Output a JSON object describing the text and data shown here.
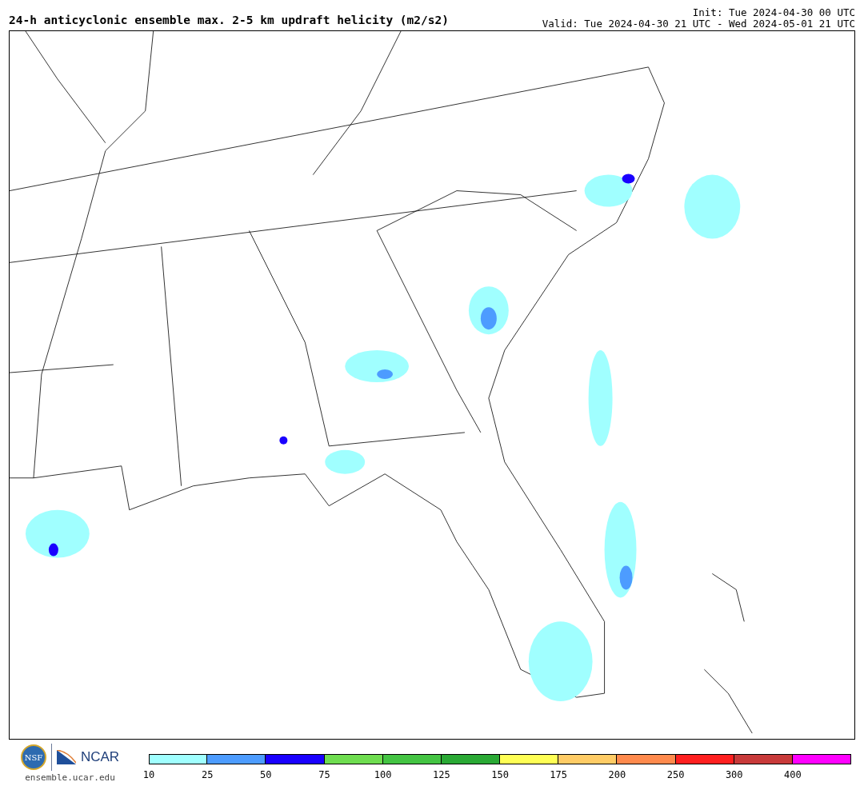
{
  "title": "24-h anticyclonic ensemble max. 2-5 km updraft helicity (m2/s2)",
  "init": "Init: Tue 2024-04-30 00 UTC",
  "valid": "Valid: Tue 2024-04-30 21 UTC - Wed 2024-05-01 21 UTC",
  "logos": {
    "nsf": "NSF",
    "ncar": "NCAR",
    "site": "ensemble.ucar.edu"
  },
  "colorbar": {
    "segments": [
      {
        "color": "#a0ffff",
        "label": "10"
      },
      {
        "color": "#4d9cff",
        "label": "25"
      },
      {
        "color": "#1a00ff",
        "label": "50"
      },
      {
        "color": "#6fdd50",
        "label": "75"
      },
      {
        "color": "#44c443",
        "label": "100"
      },
      {
        "color": "#2aa935",
        "label": "125"
      },
      {
        "color": "#ffff55",
        "label": "150"
      },
      {
        "color": "#ffcc66",
        "label": "175"
      },
      {
        "color": "#ff8a4d",
        "label": "200"
      },
      {
        "color": "#ff2020",
        "label": "250"
      },
      {
        "color": "#c83a3a",
        "label": "300"
      },
      {
        "color": "#ff00ff",
        "label": "400"
      }
    ]
  }
}
